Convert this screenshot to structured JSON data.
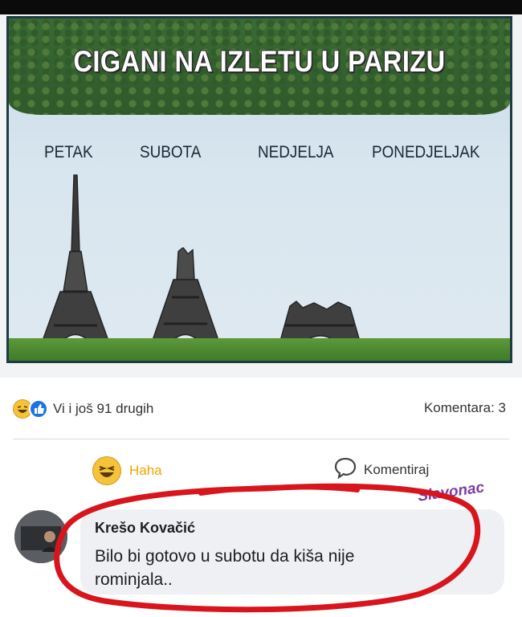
{
  "meme": {
    "title": "CIGANI NA IZLETU U PARIZU",
    "days": [
      "PETAK",
      "SUBOTA",
      "NEDJELJA",
      "PONEDJELJAK"
    ]
  },
  "post": {
    "reactions_text": "Vi i još 91 drugih",
    "comments_count": "Komentara: 3",
    "haha_label": "Haha",
    "comment_label": "Komentiraj"
  },
  "watermark": "Slavonac",
  "comment": {
    "author": "Krešo Kovačić",
    "text": "Bilo bi gotovo u subotu da kiša nije rominjala.."
  },
  "colors": {
    "haha_yellow": "#f5c33b",
    "like_blue": "#1b74e4",
    "circle_red": "#d8151c",
    "watermark_purple": "#7a3da6"
  }
}
